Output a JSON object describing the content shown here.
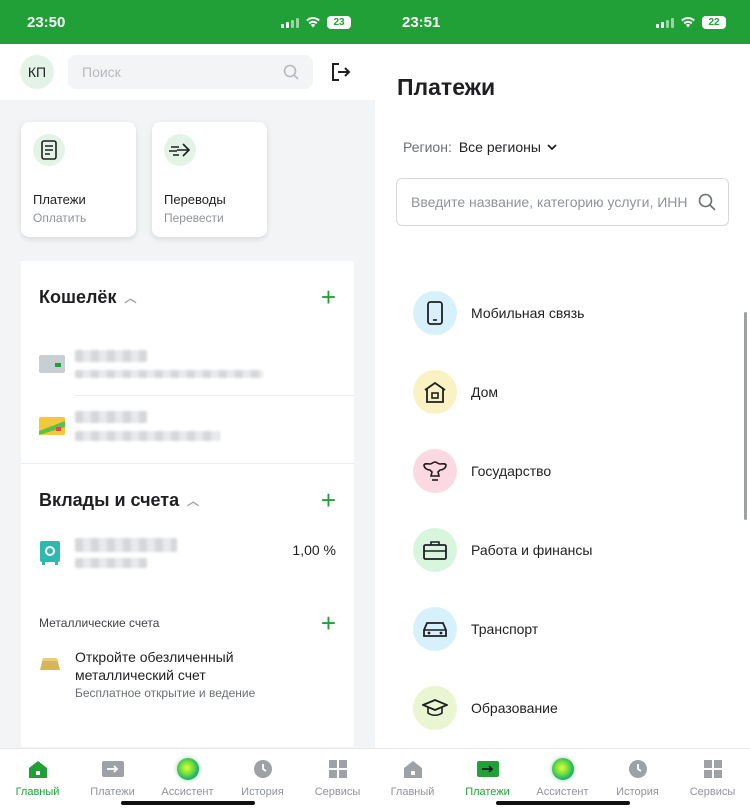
{
  "left": {
    "status": {
      "time": "23:50",
      "battery": "23"
    },
    "header": {
      "avatar_initials": "КП",
      "search_placeholder": "Поиск"
    },
    "tiles": [
      {
        "title": "Платежи",
        "subtitle": "Оплатить",
        "icon": "receipt-icon"
      },
      {
        "title": "Переводы",
        "subtitle": "Перевести",
        "icon": "arrow-transfer-icon"
      }
    ],
    "wallet": {
      "title": "Кошелёк"
    },
    "deposits": {
      "title": "Вклады и счета",
      "rate": "1,00 %"
    },
    "metal": {
      "section_label": "Металлические счета",
      "promo_title": "Откройте обезличенный металлический счет",
      "promo_subtitle": "Бесплатное открытие и ведение"
    },
    "tabs": [
      {
        "label": "Главный",
        "icon": "home-icon",
        "active": true
      },
      {
        "label": "Платежи",
        "icon": "transfer-icon",
        "active": false
      },
      {
        "label": "Ассистент",
        "icon": "assistant-orb-icon",
        "active": false
      },
      {
        "label": "История",
        "icon": "clock-icon",
        "active": false
      },
      {
        "label": "Сервисы",
        "icon": "grid-icon",
        "active": false
      }
    ]
  },
  "right": {
    "status": {
      "time": "23:51",
      "battery": "22"
    },
    "title": "Платежи",
    "region_label": "Регион:",
    "region_value": "Все регионы",
    "search_placeholder": "Введите название, категорию услуги, ИНН",
    "categories": [
      {
        "label": "Мобильная связь",
        "icon": "phone-icon",
        "bg": "#d6f1fb"
      },
      {
        "label": "Дом",
        "icon": "house-icon",
        "bg": "#fbf2c4"
      },
      {
        "label": "Государство",
        "icon": "emblem-icon",
        "bg": "#fbd9e2"
      },
      {
        "label": "Работа и финансы",
        "icon": "briefcase-icon",
        "bg": "#d8f5de"
      },
      {
        "label": "Транспорт",
        "icon": "car-icon",
        "bg": "#d6f1fb"
      },
      {
        "label": "Образование",
        "icon": "graduation-cap-icon",
        "bg": "#eaf6d2"
      }
    ],
    "tabs": [
      {
        "label": "Главный",
        "icon": "home-icon",
        "active": false
      },
      {
        "label": "Платежи",
        "icon": "transfer-icon",
        "active": true
      },
      {
        "label": "Ассистент",
        "icon": "assistant-orb-icon",
        "active": false
      },
      {
        "label": "История",
        "icon": "clock-icon",
        "active": false
      },
      {
        "label": "Сервисы",
        "icon": "grid-icon",
        "active": false
      }
    ]
  },
  "colors": {
    "brand": "#21a038",
    "text": "#1f1f22",
    "muted": "#8f9399"
  }
}
